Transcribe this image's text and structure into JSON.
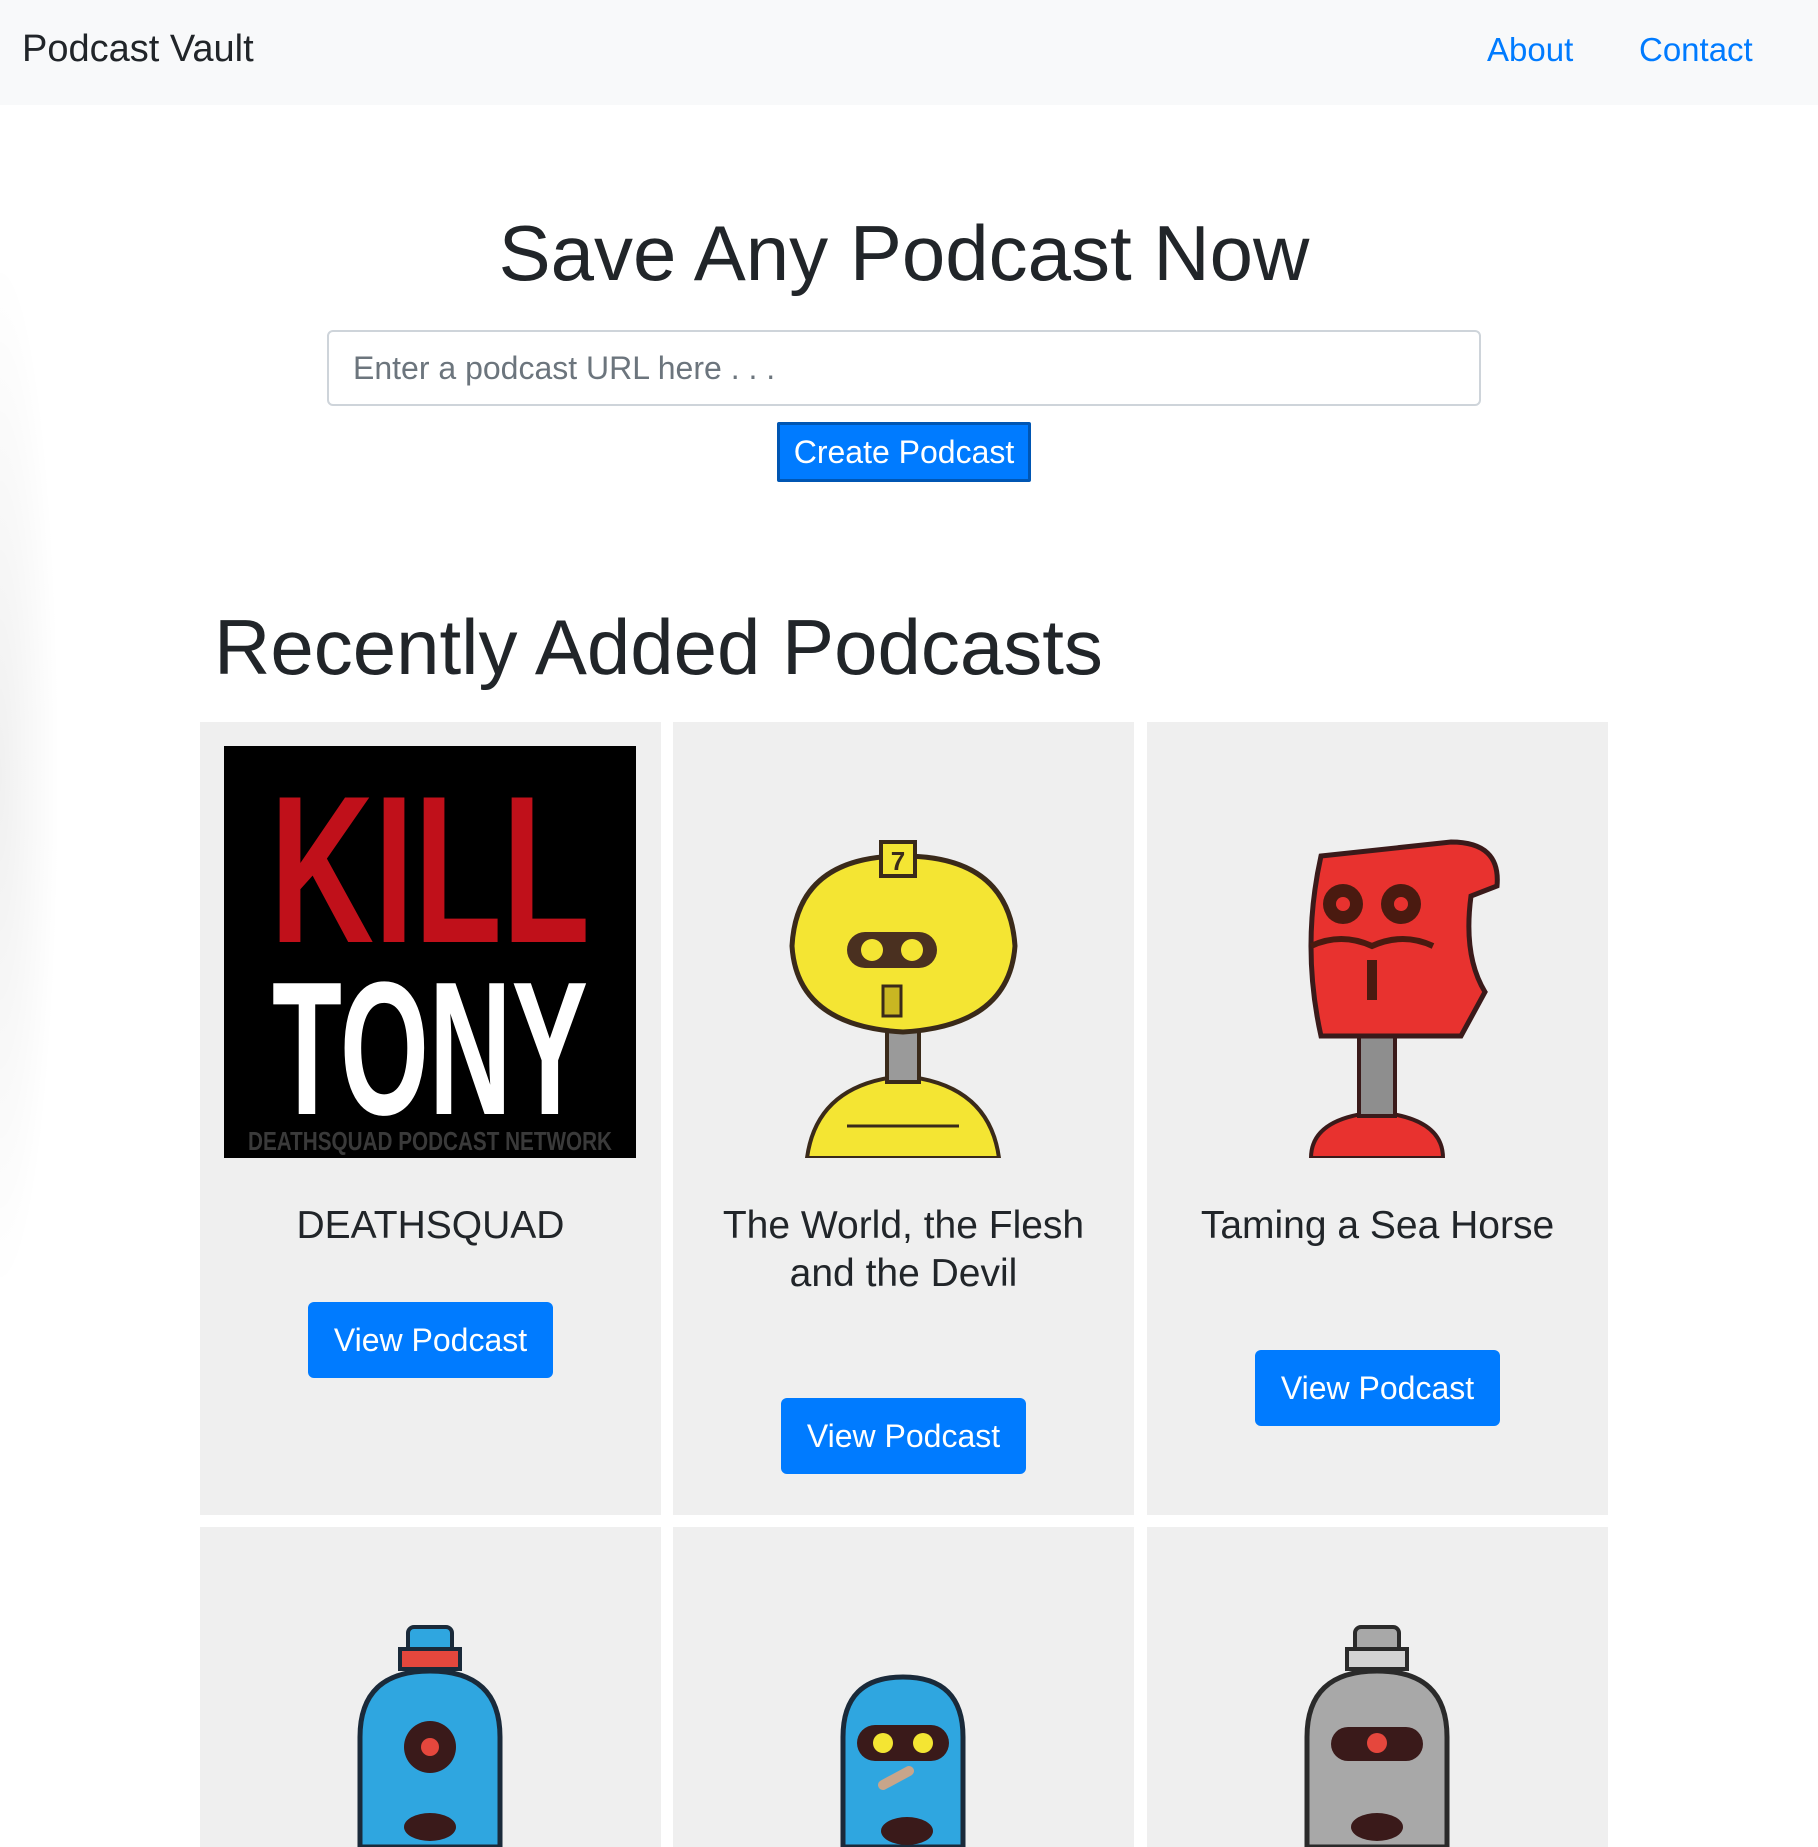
{
  "navbar": {
    "brand": "Podcast Vault",
    "links": [
      "About",
      "Contact"
    ]
  },
  "hero": {
    "title": "Save Any Podcast Now",
    "input_placeholder": "Enter a podcast URL here . . .",
    "input_value": "",
    "button_label": "Create Podcast"
  },
  "recent": {
    "title": "Recently Added Podcasts",
    "podcasts": [
      {
        "title": "DEATHSQUAD",
        "button": "View Podcast",
        "artwork": {
          "kind": "logo",
          "line1": "KILL",
          "line2": "TONY",
          "tagline": "DEATHSQUAD PODCAST NETWORK",
          "bg": "#000000",
          "accent": "#c0101a"
        }
      },
      {
        "title": "The World, the Flesh and the Devil",
        "button": "View Podcast",
        "artwork": {
          "kind": "robot",
          "color": "#f4e533",
          "badge": "7"
        }
      },
      {
        "title": "Taming a Sea Horse",
        "button": "View Podcast",
        "artwork": {
          "kind": "robot",
          "color": "#e8322f"
        }
      },
      {
        "title": "",
        "button": "",
        "artwork": {
          "kind": "robot",
          "color": "#2fa6e0",
          "cap": "#e5473d"
        }
      },
      {
        "title": "",
        "button": "",
        "artwork": {
          "kind": "robot",
          "color": "#2fa6e0"
        }
      },
      {
        "title": "",
        "button": "",
        "artwork": {
          "kind": "robot",
          "color": "#a8a8a8",
          "cap": "#d3d3d3"
        }
      }
    ]
  },
  "colors": {
    "primary": "#007bff",
    "navbar_bg": "#f8f9fa",
    "card_bg": "#efefef",
    "text": "#212529"
  }
}
